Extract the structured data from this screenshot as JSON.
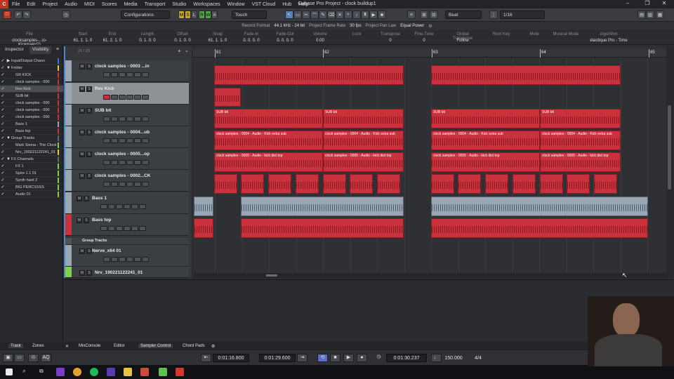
{
  "menubar": {
    "items": [
      "File",
      "Edit",
      "Project",
      "Audio",
      "MIDI",
      "Scores",
      "Media",
      "Transport",
      "Studio",
      "Workspaces",
      "Window",
      "VST Cloud",
      "Hub",
      "Help"
    ],
    "title": "Cubase Pro Project - clock buildup1",
    "minimize": "–",
    "restore": "❐",
    "close": "✕"
  },
  "toolbar": {
    "configurations": "Configurations",
    "touch": "Touch",
    "grid": "Beat",
    "quantize": "1/16",
    "modes": [
      "M",
      "S",
      "L",
      "R",
      "W",
      "A"
    ]
  },
  "statusline": [
    {
      "label": "Record Format",
      "value": "44.1 kHz - 24 bit"
    },
    {
      "label": "Project Frame Rate",
      "value": "30 fps"
    },
    {
      "label": "Project Pan Law",
      "value": "Equal Power"
    }
  ],
  "infoline": {
    "headers": [
      "File",
      "Start",
      "End",
      "Length",
      "Offset",
      "Snap",
      "Fade-In",
      "Fade-Out",
      "Volume",
      "Lock",
      "Transpose",
      "Fine-Tune",
      "Global Transpose",
      "Root Key",
      "Mute",
      "Musical Mode",
      "Algorithm"
    ],
    "values": [
      "clocksamples-...io-Kickmain(2)",
      "61. 1. 1. 0",
      "61. 2. 1. 0",
      "0. 1. 0. 0",
      "0. 1. 0. 0",
      "61. 1. 1. 0",
      "0. 0. 0. 0",
      "0. 0. 0. 0",
      "0.00",
      "",
      "0",
      "0",
      "Follow",
      "",
      "",
      "",
      "élastique Pro - Time"
    ]
  },
  "inspector": {
    "tab_inspector": "Inspector",
    "tab_visibility": "Visibility",
    "items": [
      {
        "label": "Input/Output Chann",
        "arrow": "▶",
        "color": "#3a7bd5"
      },
      {
        "label": "Folder",
        "arrow": "▼",
        "color": "#e0d030"
      },
      {
        "label": "GR KICK",
        "arrow": "",
        "color": "#c9323d"
      },
      {
        "label": "clock samples - 000",
        "arrow": "",
        "color": "#c9323d"
      },
      {
        "label": "Rev Kick",
        "arrow": "",
        "color": "#c9323d",
        "selected": true
      },
      {
        "label": "SUB bit",
        "arrow": "",
        "color": "#c9323d"
      },
      {
        "label": "clock samples - 000",
        "arrow": "",
        "color": "#c9323d"
      },
      {
        "label": "clock samples - 000",
        "arrow": "",
        "color": "#c9323d"
      },
      {
        "label": "clock samples - 000",
        "arrow": "",
        "color": "#c9323d"
      },
      {
        "label": "Bass 1",
        "arrow": "",
        "color": "#9aa6b3"
      },
      {
        "label": "Bass top",
        "arrow": "",
        "color": "#c9323d"
      },
      {
        "label": "Group Tracks",
        "arrow": "▼",
        "color": "#5d6a7a"
      },
      {
        "label": "Mark Sixma - The Clock",
        "arrow": "",
        "color": "#7fd04a"
      },
      {
        "label": "Nrv_190221122241_01",
        "arrow": "",
        "color": "#e0d030"
      },
      {
        "label": "FX Channels",
        "arrow": "▼",
        "color": "#5d6a7a"
      },
      {
        "label": "FX 1",
        "arrow": "",
        "color": "#7fd04a"
      },
      {
        "label": "Spire-1.1 01",
        "arrow": "",
        "color": "#7fd04a"
      },
      {
        "label": "Synth hard 2",
        "arrow": "",
        "color": "#7fd04a"
      },
      {
        "label": "BIG PERCSSSS",
        "arrow": "",
        "color": "#7fd04a"
      },
      {
        "label": "Audio 01",
        "arrow": "",
        "color": "#7fd04a"
      }
    ]
  },
  "tracklist": {
    "counter": "21 / 23",
    "tracks": [
      {
        "name": "clock samples - 0003 ...in",
        "color": "#9aa6b3"
      },
      {
        "name": "Rev Kick",
        "color": "#9aa6b3",
        "selected": true
      },
      {
        "name": "SUB bit",
        "color": "#9aa6b3"
      },
      {
        "name": "clock samples - 0004...ub",
        "color": "#9aa6b3"
      },
      {
        "name": "clock samples - 0005...op",
        "color": "#9aa6b3"
      },
      {
        "name": "clock samples - 0002...CK",
        "color": "#9aa6b3"
      },
      {
        "name": "Bass 1",
        "color": "#9aa6b3"
      },
      {
        "name": "Bass top",
        "color": "#c9323d"
      },
      {
        "name": "Group Tracks",
        "color": "#4f5258"
      },
      {
        "name": "Nerve_x64 01",
        "color": "#9aa6b3"
      },
      {
        "name": "Nrv_190221122241_01",
        "color": "#7fd04a"
      }
    ]
  },
  "ruler": {
    "bars": [
      "61",
      "62",
      "63",
      "64",
      "65"
    ]
  },
  "events": {
    "sub": "SUB bit",
    "s4": "clock samples - 0004 - Audio - Kick extra sub",
    "s5": "clock samples - 0005 - Audio - kick dist top"
  },
  "bottomtabs": [
    "Track",
    "Zones",
    "MixConsole",
    "Editor",
    "Sampler Control",
    "Chord Pads"
  ],
  "transport": {
    "left_locator": "0:01:16.800",
    "right_locator": "0:01:29.600",
    "position": "0:01:30.237",
    "tempo": "150.000",
    "signature": "4/4"
  }
}
